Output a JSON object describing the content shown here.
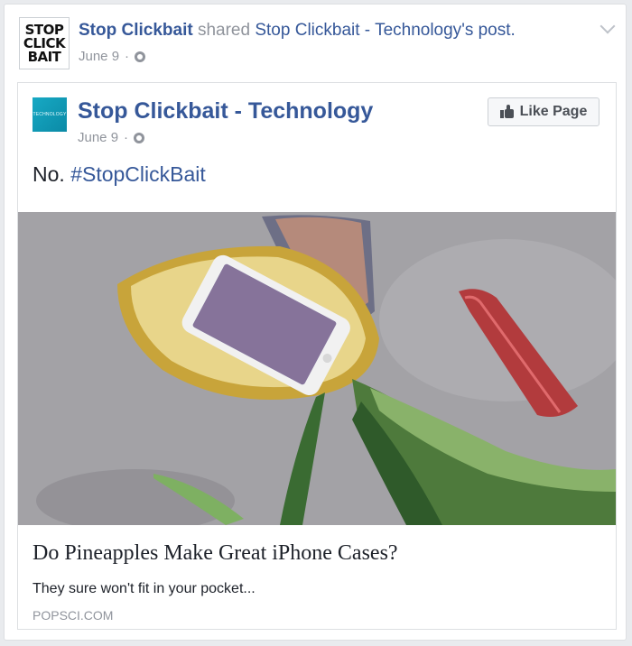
{
  "share_header": {
    "actor": "Stop Clickbait",
    "verb": "shared",
    "page_name": "Stop Clickbait - Technology",
    "possessive": "'s",
    "object": "post",
    "period": ".",
    "date": "June 9",
    "dot": "·",
    "avatar_lines": [
      "STOP",
      "CLICK",
      "BAIT"
    ]
  },
  "inner_post": {
    "page_name": "Stop Clickbait - Technology",
    "avatar_text": "TECHNOLOGY",
    "date": "June 9",
    "dot": "·",
    "like_button_label": "Like Page",
    "status_text": "No.",
    "hashtag": "#StopClickBait"
  },
  "link_preview": {
    "title": "Do Pineapples Make Great iPhone Cases?",
    "description": "They sure won't fit in your pocket...",
    "domain": "POPSCI.COM"
  },
  "icons": {
    "privacy": "globe-icon",
    "menu": "chevron-down-icon",
    "like": "thumbs-up-icon"
  },
  "colors": {
    "link": "#365899",
    "muted": "#90949c",
    "background": "#e9ebee"
  }
}
